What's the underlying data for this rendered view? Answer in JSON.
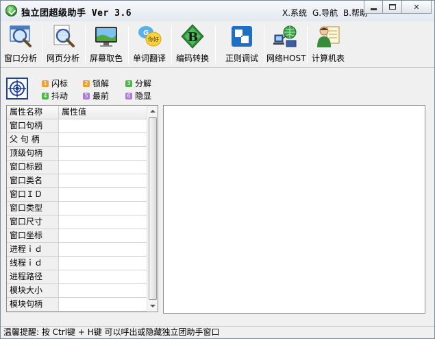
{
  "window": {
    "title": "独立团超级助手 Ver 3.6",
    "menu": [
      "X.系统",
      "G.导航",
      "B.帮助"
    ]
  },
  "toolbar": {
    "items": [
      {
        "label": "窗口分析",
        "icon": "magnifier-window-icon"
      },
      {
        "label": "网页分析",
        "icon": "magnifier-page-icon"
      },
      {
        "label": "屏幕取色",
        "icon": "monitor-landscape-icon"
      },
      {
        "label": "单词翻译",
        "icon": "speech-bubble-hello-icon"
      },
      {
        "label": "编码转换",
        "icon": "letter-b-icon"
      },
      {
        "label": "正则调试",
        "icon": "regex-squares-icon"
      },
      {
        "label": "网络HOST",
        "icon": "network-globe-icon"
      },
      {
        "label": "计算机表",
        "icon": "person-table-icon"
      }
    ]
  },
  "options": [
    {
      "num": "1",
      "label": "闪标",
      "color": "#f0a030"
    },
    {
      "num": "2",
      "label": "锁解",
      "color": "#f0a030"
    },
    {
      "num": "3",
      "label": "分解",
      "color": "#4cb848"
    },
    {
      "num": "4",
      "label": "抖动",
      "color": "#4cb848"
    },
    {
      "num": "5",
      "label": "最前",
      "color": "#b07ad8"
    },
    {
      "num": "6",
      "label": "隐显",
      "color": "#b07ad8"
    }
  ],
  "property_table": {
    "headers": [
      "属性名称",
      "属性值"
    ],
    "rows": [
      {
        "name": "窗口句柄",
        "value": ""
      },
      {
        "name": "父 句 柄",
        "value": ""
      },
      {
        "name": "顶级句柄",
        "value": ""
      },
      {
        "name": "窗口标题",
        "value": ""
      },
      {
        "name": "窗口类名",
        "value": ""
      },
      {
        "name": "窗口ＩＤ",
        "value": ""
      },
      {
        "name": "窗口类型",
        "value": ""
      },
      {
        "name": "窗口尺寸",
        "value": ""
      },
      {
        "name": "窗口坐标",
        "value": ""
      },
      {
        "name": "进程ｉｄ",
        "value": ""
      },
      {
        "name": "线程ｉｄ",
        "value": ""
      },
      {
        "name": "进程路径",
        "value": ""
      },
      {
        "name": "模块大小",
        "value": ""
      },
      {
        "name": "模块句柄",
        "value": ""
      }
    ]
  },
  "status": {
    "text": "温馨提醒: 按 Ctrl键 + H键 可以呼出或隐藏独立团助手窗口"
  }
}
